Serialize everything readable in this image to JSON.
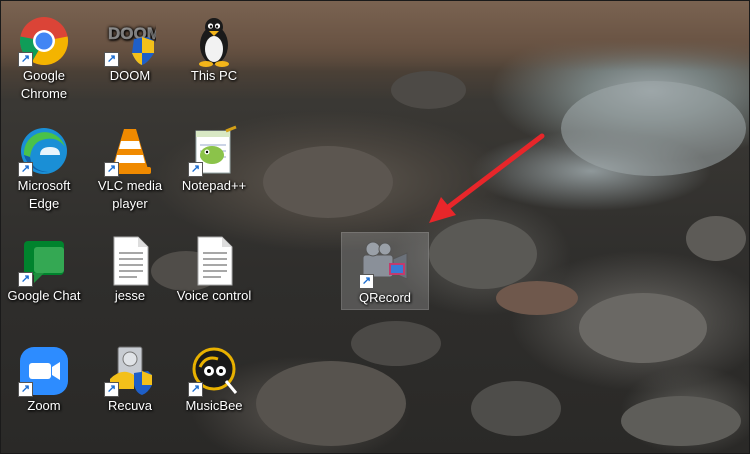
{
  "desktop": {
    "icons": [
      {
        "label": "Google Chrome"
      },
      {
        "label": "DOOM"
      },
      {
        "label": "This PC"
      },
      {
        "label": "Microsoft Edge"
      },
      {
        "label": "VLC media player"
      },
      {
        "label": "Notepad++"
      },
      {
        "label": "Google Chat"
      },
      {
        "label": "jesse"
      },
      {
        "label": "Voice control"
      },
      {
        "label": "QRecord"
      },
      {
        "label": "Zoom"
      },
      {
        "label": "Recuva"
      },
      {
        "label": "MusicBee"
      }
    ],
    "doom_logo_text": "DOOM",
    "selected_icon": "QRecord",
    "annotation_color": "#e8262a"
  }
}
